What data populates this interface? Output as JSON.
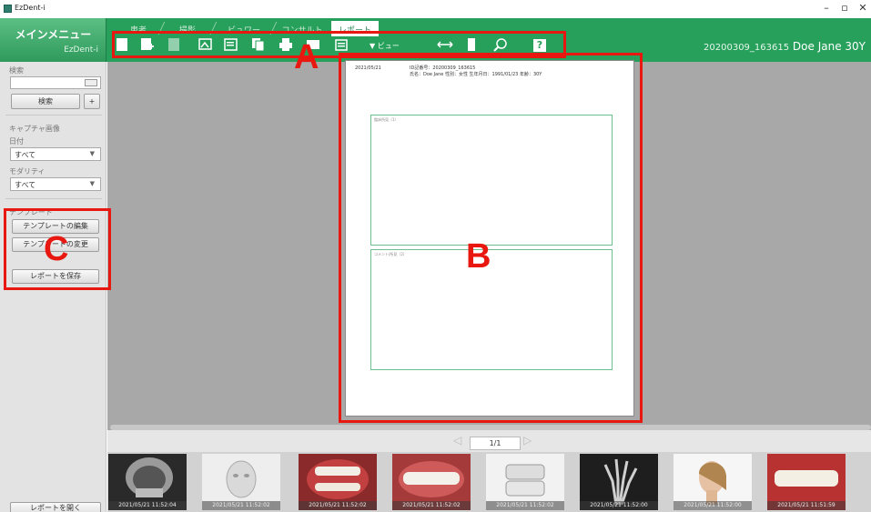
{
  "window": {
    "title": "EzDent-i",
    "minimize": "–",
    "maximize": "▫",
    "close": "✕"
  },
  "main_menu": {
    "label": "メインメニュー",
    "sub": "EzDent-i"
  },
  "tabs": [
    "患者",
    "撮影",
    "ビュワー",
    "コンサルト",
    "レポート"
  ],
  "toolbar": {
    "view_label": "ビュー",
    "help": "?"
  },
  "patient": {
    "id": "20200309_163615",
    "name": "Doe Jane 30Y"
  },
  "sidebar": {
    "search_label": "検索",
    "search_value": "",
    "search_button": "検索",
    "add_button": "+",
    "capture_label": "キャプチャ画像",
    "date_label": "日付",
    "date_value": "すべて",
    "modality_label": "モダリティ",
    "modality_value": "すべて",
    "template_label": "テンプレート",
    "edit_template": "テンプレートの編集",
    "change_template": "テンプレートの変更",
    "save_report": "レポートを保存",
    "open_report": "レポートを開く"
  },
  "report_page": {
    "date": "2021/05/21",
    "line1": "ID記番号：20200309_163615",
    "line2": "氏名：Doe Jane 性別：女性 生年月日：1991/01/23 年齢：30Y",
    "box1_label": "臨床所見（1）",
    "box2_label": "コメント/所見（2）"
  },
  "pager": {
    "text": "1/1",
    "prev": "◁",
    "next": "▷"
  },
  "thumbnails": [
    {
      "caption": "2021/05/21 11:52:04",
      "kind": "ceph-xray"
    },
    {
      "caption": "2021/05/21 11:52:02",
      "kind": "face-3d"
    },
    {
      "caption": "2021/05/21 11:52:02",
      "kind": "mouth-photo"
    },
    {
      "caption": "2021/05/21 11:52:02",
      "kind": "teeth-photo"
    },
    {
      "caption": "2021/05/21 11:52:02",
      "kind": "model-scan"
    },
    {
      "caption": "2021/05/21 11:52:00",
      "kind": "hand-xray"
    },
    {
      "caption": "2021/05/21 11:52:00",
      "kind": "profile-photo"
    },
    {
      "caption": "2021/05/21 11:51:59",
      "kind": "teeth-closeup"
    }
  ],
  "annotations": {
    "a": "A",
    "b": "B",
    "c": "C"
  },
  "colors": {
    "accent": "#26a05a",
    "highlight": "#e8170f"
  }
}
